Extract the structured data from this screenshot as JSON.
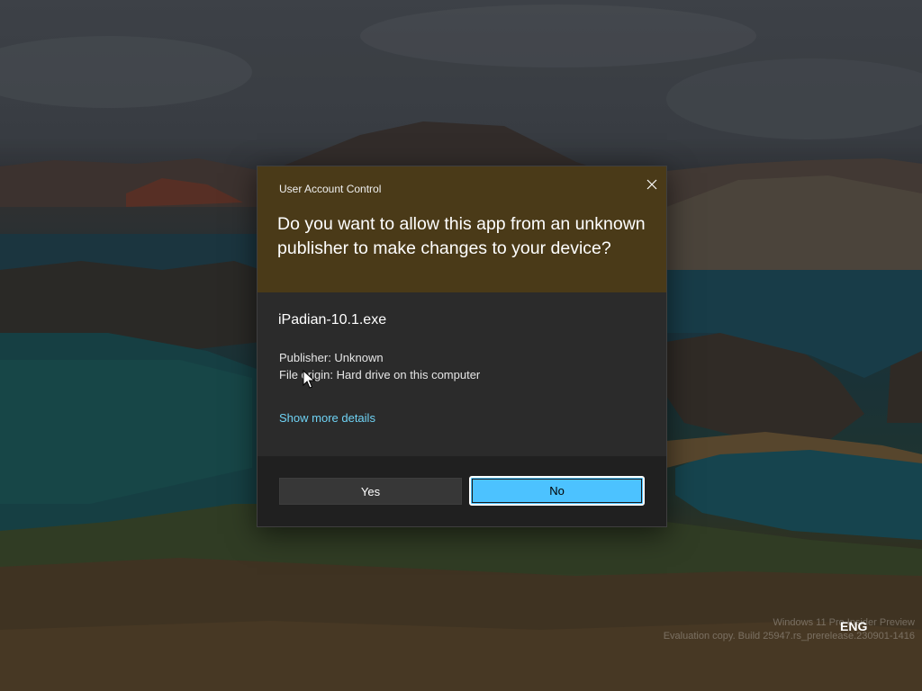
{
  "dialog": {
    "title": "User Account Control",
    "question": "Do you want to allow this app from an unknown publisher to make changes to your device?",
    "app_name": "iPadian-10.1.exe",
    "publisher": "Publisher: Unknown",
    "file_origin": "File origin: Hard drive on this computer",
    "show_more": "Show more details",
    "yes_label": "Yes",
    "no_label": "No",
    "close_icon": "close-icon",
    "colors": {
      "header": "#4a3a18",
      "body": "#2b2b2b",
      "footer": "#202020",
      "accent": "#4cc2ff",
      "link": "#6fd3f5"
    }
  },
  "desktop": {
    "watermark_line1": "Windows 11 Pro Insider Preview",
    "watermark_line2": "Evaluation copy. Build 25947.rs_prerelease.230901-1416",
    "language": "ENG"
  }
}
